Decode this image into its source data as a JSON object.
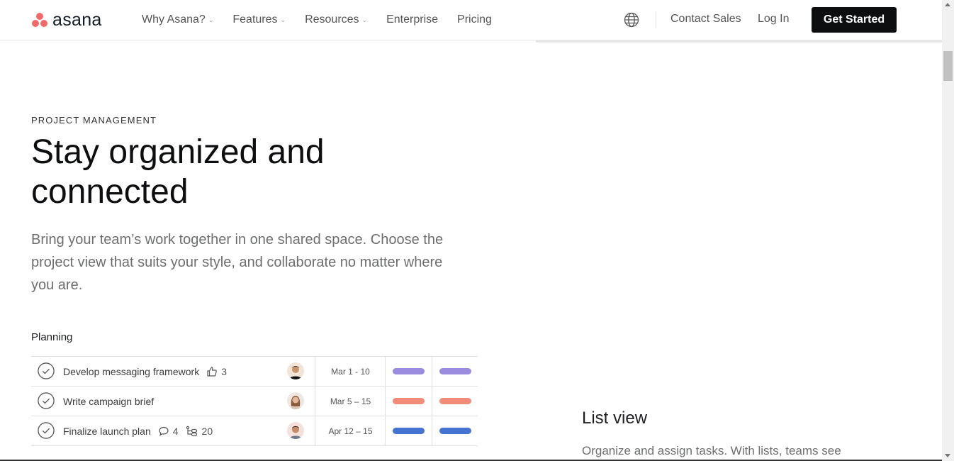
{
  "nav": {
    "logo_text": "asana",
    "links": [
      {
        "label": "Why Asana?",
        "has_dropdown": true
      },
      {
        "label": "Features",
        "has_dropdown": true
      },
      {
        "label": "Resources",
        "has_dropdown": true
      },
      {
        "label": "Enterprise",
        "has_dropdown": false
      },
      {
        "label": "Pricing",
        "has_dropdown": false
      }
    ],
    "globe_icon": "globe-icon",
    "contact_sales": "Contact Sales",
    "log_in": "Log In",
    "get_started": "Get Started"
  },
  "hero": {
    "eyebrow": "PROJECT MANAGEMENT",
    "headline": "Stay organized and connected",
    "body": "Bring your team’s work together in one shared space. Choose the project view that suits your style, and collaborate no matter where you are."
  },
  "planning": {
    "label": "Planning",
    "rows": [
      {
        "task": "Develop messaging framework",
        "meta": [
          {
            "icon": "thumbs-up-icon",
            "count": "3"
          }
        ],
        "date": "Mar 1 - 10",
        "color": "#9b8ce0"
      },
      {
        "task": "Write campaign brief",
        "meta": [],
        "date": "Mar 5 – 15",
        "color": "#f08c78"
      },
      {
        "task": "Finalize launch plan",
        "meta": [
          {
            "icon": "comment-icon",
            "count": "4"
          },
          {
            "icon": "subtask-icon",
            "count": "20"
          }
        ],
        "date": "Apr 12 – 15",
        "color": "#4573d2"
      }
    ]
  },
  "list_view": {
    "title": "List view",
    "description": "Organize and assign tasks. With lists, teams see"
  },
  "colors": {
    "brand": "#f06a6a",
    "cta_bg": "#0d0e10"
  }
}
